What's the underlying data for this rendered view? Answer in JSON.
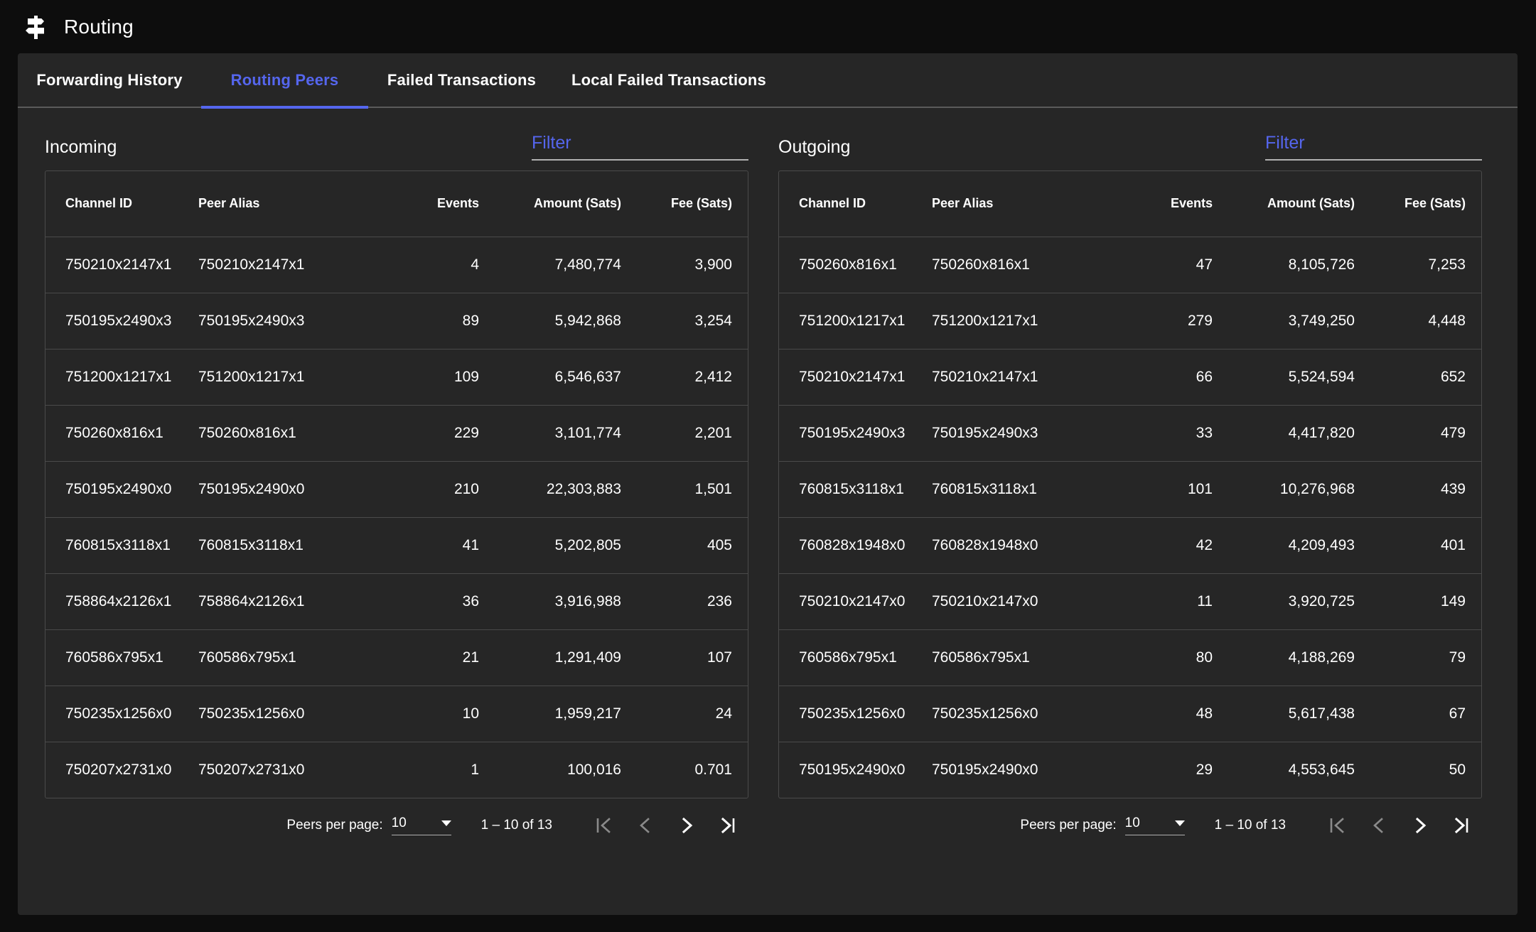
{
  "header": {
    "icon": "signpost-icon",
    "title": "Routing"
  },
  "tabs": [
    {
      "label": "Forwarding History",
      "active": false
    },
    {
      "label": "Routing Peers",
      "active": true
    },
    {
      "label": "Failed Transactions",
      "active": false
    },
    {
      "label": "Local Failed Transactions",
      "active": false
    }
  ],
  "colors": {
    "accent": "#5566ee",
    "page_background": "#0d0d0d",
    "card_background": "#262626",
    "border": "#4a4a4a",
    "text": "#ffffff"
  },
  "columns": [
    "Channel ID",
    "Peer Alias",
    "Events",
    "Amount (Sats)",
    "Fee (Sats)"
  ],
  "incoming": {
    "label": "Incoming",
    "filter": {
      "placeholder": "Filter",
      "value": ""
    },
    "rows": [
      {
        "channel_id": "750210x2147x1",
        "peer_alias": "750210x2147x1",
        "events": "4",
        "amount": "7,480,774",
        "fee": "3,900"
      },
      {
        "channel_id": "750195x2490x3",
        "peer_alias": "750195x2490x3",
        "events": "89",
        "amount": "5,942,868",
        "fee": "3,254"
      },
      {
        "channel_id": "751200x1217x1",
        "peer_alias": "751200x1217x1",
        "events": "109",
        "amount": "6,546,637",
        "fee": "2,412"
      },
      {
        "channel_id": "750260x816x1",
        "peer_alias": "750260x816x1",
        "events": "229",
        "amount": "3,101,774",
        "fee": "2,201"
      },
      {
        "channel_id": "750195x2490x0",
        "peer_alias": "750195x2490x0",
        "events": "210",
        "amount": "22,303,883",
        "fee": "1,501"
      },
      {
        "channel_id": "760815x3118x1",
        "peer_alias": "760815x3118x1",
        "events": "41",
        "amount": "5,202,805",
        "fee": "405"
      },
      {
        "channel_id": "758864x2126x1",
        "peer_alias": "758864x2126x1",
        "events": "36",
        "amount": "3,916,988",
        "fee": "236"
      },
      {
        "channel_id": "760586x795x1",
        "peer_alias": "760586x795x1",
        "events": "21",
        "amount": "1,291,409",
        "fee": "107"
      },
      {
        "channel_id": "750235x1256x0",
        "peer_alias": "750235x1256x0",
        "events": "10",
        "amount": "1,959,217",
        "fee": "24"
      },
      {
        "channel_id": "750207x2731x0",
        "peer_alias": "750207x2731x0",
        "events": "1",
        "amount": "100,016",
        "fee": "0.701"
      }
    ],
    "paginator": {
      "items_per_page_label": "Peers per page:",
      "page_size": "10",
      "range_label": "1 – 10 of 13"
    }
  },
  "outgoing": {
    "label": "Outgoing",
    "filter": {
      "placeholder": "Filter",
      "value": ""
    },
    "rows": [
      {
        "channel_id": "750260x816x1",
        "peer_alias": "750260x816x1",
        "events": "47",
        "amount": "8,105,726",
        "fee": "7,253"
      },
      {
        "channel_id": "751200x1217x1",
        "peer_alias": "751200x1217x1",
        "events": "279",
        "amount": "3,749,250",
        "fee": "4,448"
      },
      {
        "channel_id": "750210x2147x1",
        "peer_alias": "750210x2147x1",
        "events": "66",
        "amount": "5,524,594",
        "fee": "652"
      },
      {
        "channel_id": "750195x2490x3",
        "peer_alias": "750195x2490x3",
        "events": "33",
        "amount": "4,417,820",
        "fee": "479"
      },
      {
        "channel_id": "760815x3118x1",
        "peer_alias": "760815x3118x1",
        "events": "101",
        "amount": "10,276,968",
        "fee": "439"
      },
      {
        "channel_id": "760828x1948x0",
        "peer_alias": "760828x1948x0",
        "events": "42",
        "amount": "4,209,493",
        "fee": "401"
      },
      {
        "channel_id": "750210x2147x0",
        "peer_alias": "750210x2147x0",
        "events": "11",
        "amount": "3,920,725",
        "fee": "149"
      },
      {
        "channel_id": "760586x795x1",
        "peer_alias": "760586x795x1",
        "events": "80",
        "amount": "4,188,269",
        "fee": "79"
      },
      {
        "channel_id": "750235x1256x0",
        "peer_alias": "750235x1256x0",
        "events": "48",
        "amount": "5,617,438",
        "fee": "67"
      },
      {
        "channel_id": "750195x2490x0",
        "peer_alias": "750195x2490x0",
        "events": "29",
        "amount": "4,553,645",
        "fee": "50"
      }
    ],
    "paginator": {
      "items_per_page_label": "Peers per page:",
      "page_size": "10",
      "range_label": "1 – 10 of 13"
    }
  }
}
